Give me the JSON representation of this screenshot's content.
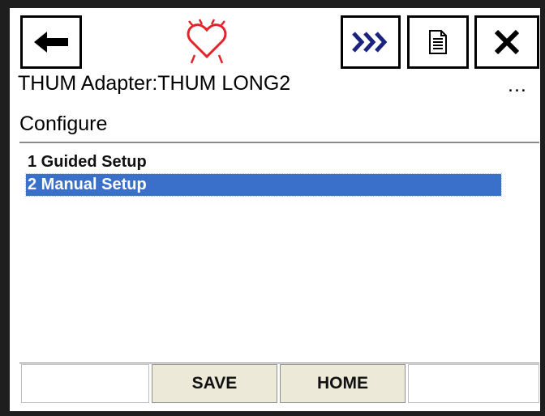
{
  "device": {
    "title": "THUM Adapter:THUM LONG2",
    "more": "...",
    "subtitle": "Configure"
  },
  "toolbar": {
    "icons": [
      "back-arrow-icon",
      "heart-status-icon",
      "fast-forward-icon",
      "document-icon",
      "close-icon"
    ],
    "heart_color": "#e0242a",
    "forward_color": "#1a237e"
  },
  "menu": {
    "items": [
      {
        "label": "1 Guided Setup",
        "selected": false
      },
      {
        "label": "2 Manual Setup",
        "selected": true
      }
    ],
    "selection_color": "#3a70c9"
  },
  "softkeys": {
    "save_label": "SAVE",
    "home_label": "HOME"
  }
}
